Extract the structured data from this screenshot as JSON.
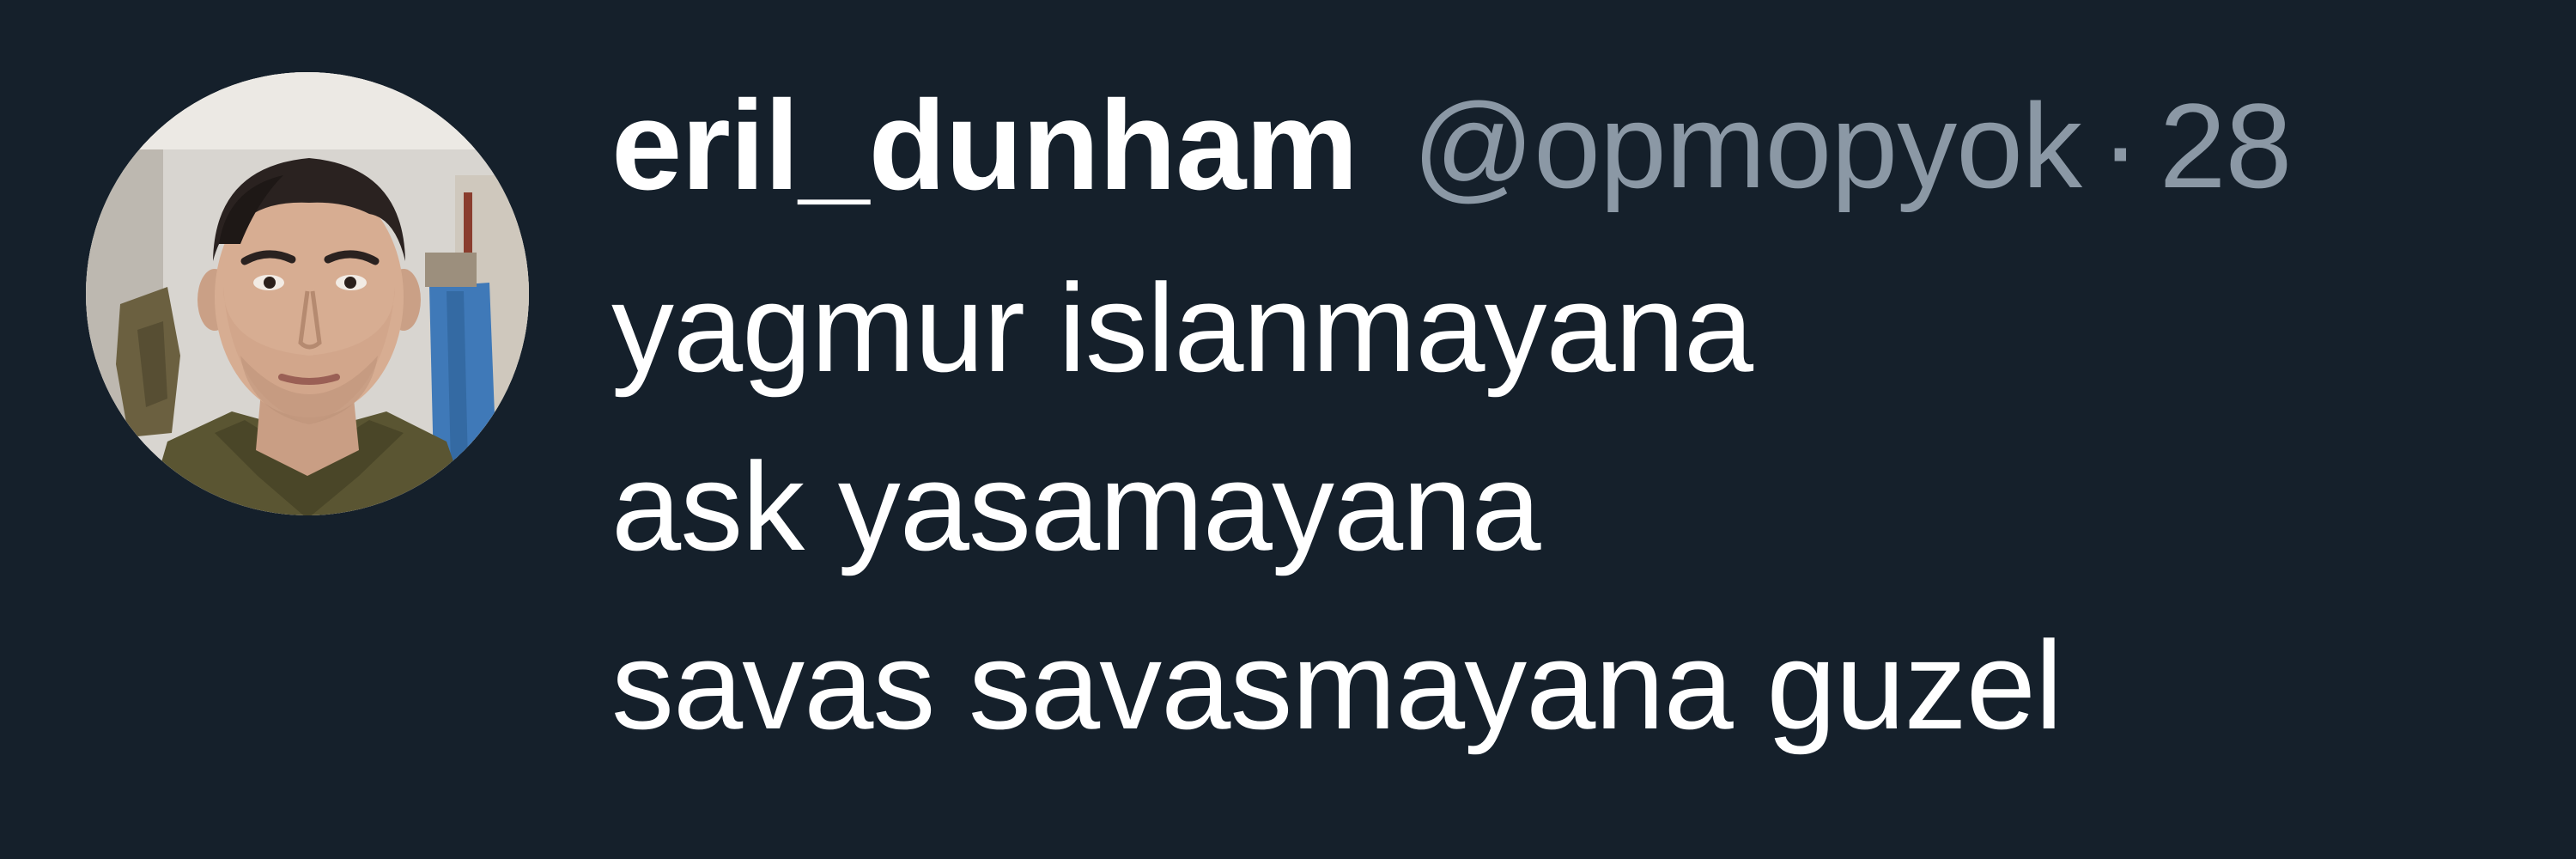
{
  "tweet": {
    "display_name": "eril_dunham",
    "handle": "@opmopyok",
    "separator": "·",
    "time": "28",
    "lines": [
      "yagmur islanmayana",
      "ask yasamayana",
      "savas savasmayana guzel"
    ]
  },
  "colors": {
    "background": "#15202b",
    "primary_text": "#ffffff",
    "secondary_text": "#8b98a5"
  }
}
